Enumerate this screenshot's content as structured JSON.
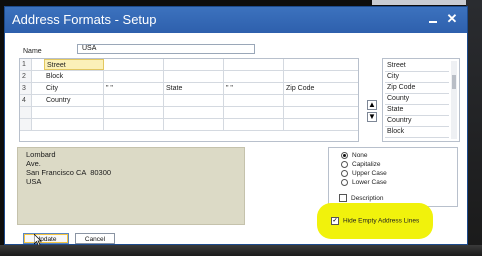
{
  "window": {
    "title": "Address Formats - Setup"
  },
  "name_field": {
    "label": "Name",
    "value": "USA"
  },
  "grid": {
    "rows": [
      {
        "num": "1",
        "cells": [
          "Street",
          "",
          "",
          "",
          ""
        ]
      },
      {
        "num": "2",
        "cells": [
          "Block",
          "",
          "",
          "",
          ""
        ]
      },
      {
        "num": "3",
        "cells": [
          "City",
          "\" \"",
          "State",
          "\" \"",
          "Zip Code"
        ]
      },
      {
        "num": "4",
        "cells": [
          "Country",
          "",
          "",
          "",
          ""
        ]
      },
      {
        "num": "",
        "cells": [
          "",
          "",
          "",
          "",
          ""
        ]
      },
      {
        "num": "",
        "cells": [
          "",
          "",
          "",
          "",
          ""
        ]
      },
      {
        "num": "",
        "cells": [
          "",
          "",
          "",
          "",
          ""
        ]
      }
    ]
  },
  "field_list": {
    "items": [
      "Street",
      "City",
      "Zip Code",
      "County",
      "State",
      "Country",
      "Block"
    ]
  },
  "preview": {
    "lines": [
      "Lombard",
      "Ave.",
      "San Francisco CA  80300",
      "USA"
    ]
  },
  "options": {
    "case_options": [
      "None",
      "Capitalize",
      "Upper Case",
      "Lower Case"
    ],
    "selected_case": "None",
    "description_label": "Description",
    "hide_empty_label": "Hide Empty Address Lines"
  },
  "buttons": {
    "update": "Update",
    "cancel": "Cancel"
  },
  "colors": {
    "titlebar": "#3366b3",
    "highlight": "#f1f20c",
    "preview_bg": "#dcdac6"
  }
}
